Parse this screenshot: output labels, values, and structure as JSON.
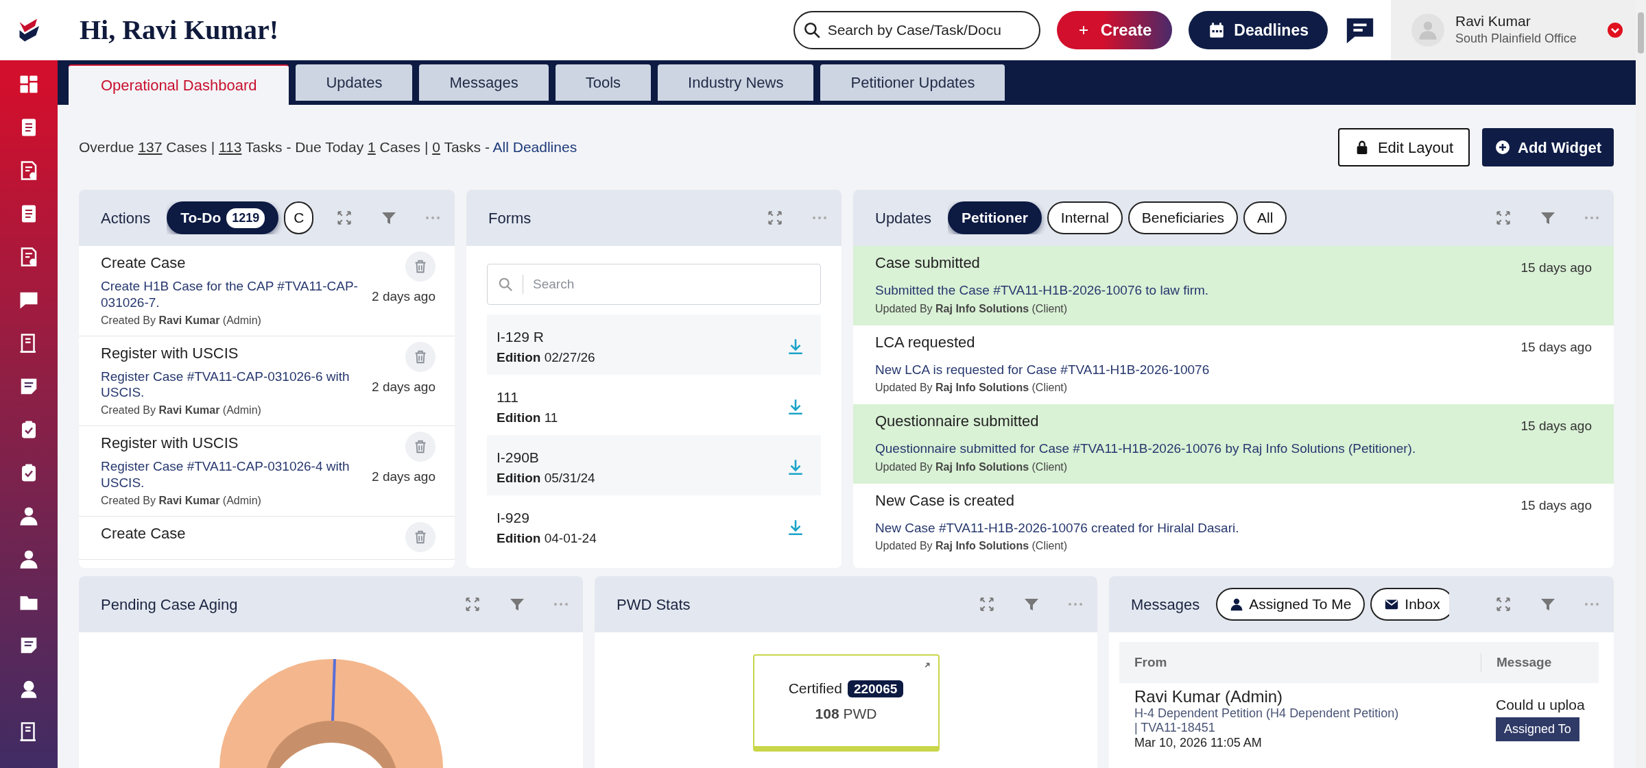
{
  "header": {
    "greeting": "Hi, Ravi Kumar!",
    "search": {
      "placeholder": "Search by Case/Task/Docu"
    },
    "create_button": "Create",
    "deadlines_button": "Deadlines",
    "user": {
      "name": "Ravi Kumar",
      "office": "South Plainfield Office"
    }
  },
  "tabs": [
    {
      "label": "Operational Dashboard",
      "selected": true
    },
    {
      "label": "Updates",
      "selected": false
    },
    {
      "label": "Messages",
      "selected": false
    },
    {
      "label": "Tools",
      "selected": false
    },
    {
      "label": "Industry News",
      "selected": false
    },
    {
      "label": "Petitioner Updates",
      "selected": false
    }
  ],
  "summary": [
    {
      "kind": "text",
      "text": "Overdue "
    },
    {
      "kind": "count",
      "text": "137"
    },
    {
      "kind": "text",
      "text": " Cases | "
    },
    {
      "kind": "count",
      "text": "113"
    },
    {
      "kind": "text",
      "text": " Tasks - Due Today "
    },
    {
      "kind": "count",
      "text": "1"
    },
    {
      "kind": "text",
      "text": " Cases | "
    },
    {
      "kind": "count",
      "text": "0"
    },
    {
      "kind": "text",
      "text": " Tasks - "
    },
    {
      "kind": "link",
      "text": "All Deadlines"
    }
  ],
  "toolbar": {
    "edit_layout": "Edit Layout",
    "add_widget": "Add Widget"
  },
  "actions": {
    "title": "Actions",
    "filters": [
      {
        "label": "To-Do",
        "count": "1219",
        "selected": true
      },
      {
        "label": "C",
        "selected": false
      }
    ],
    "items": [
      {
        "title": "Create Case",
        "description": "Create H1B Case for the CAP #TVA11-CAP-031026-7.",
        "created_by": "Created By **Ravi Kumar** (Admin)",
        "time": "2 days ago"
      },
      {
        "title": "Register with USCIS",
        "description": "Register Case #TVA11-CAP-031026-6 with USCIS.",
        "created_by": "Created By **Ravi Kumar** (Admin)",
        "time": "2 days ago"
      },
      {
        "title": "Register with USCIS",
        "description": "Register Case #TVA11-CAP-031026-4 with USCIS.",
        "created_by": "Created By **Ravi Kumar** (Admin)",
        "time": "2 days ago"
      },
      {
        "title": "Create Case"
      }
    ]
  },
  "forms": {
    "title": "Forms",
    "search": {
      "placeholder": "Search"
    },
    "items": [
      {
        "name": "I-129 R",
        "edition": "**Edition** 02/27/26"
      },
      {
        "name": "111",
        "edition": "**Edition** 11"
      },
      {
        "name": "I-290B",
        "edition": "**Edition** 05/31/24"
      },
      {
        "name": "I-929",
        "edition": "**Edition** 04-01-24"
      }
    ]
  },
  "updates": {
    "title": "Updates",
    "filters": [
      {
        "label": "Petitioner",
        "selected": true
      },
      {
        "label": "Internal",
        "selected": false
      },
      {
        "label": "Beneficiaries",
        "selected": false
      },
      {
        "label": "All",
        "selected": false
      }
    ],
    "items": [
      {
        "title": "Case submitted",
        "description": "Submitted the Case #TVA11-H1B-2026-10076 to law firm.",
        "updated_by": "Updated By **Raj Info Solutions** (Client)",
        "time": "15 days ago",
        "highlighted": true
      },
      {
        "title": "LCA requested",
        "description": "New LCA is requested for Case #TVA11-H1B-2026-10076",
        "updated_by": "Updated By **Raj Info Solutions** (Client)",
        "time": "15 days ago",
        "highlighted": false
      },
      {
        "title": "Questionnaire submitted",
        "description": "Questionnaire submitted for Case #TVA11-H1B-2026-10076 by Raj Info Solutions (Petitioner).",
        "updated_by": "Updated By **Raj Info Solutions** (Client)",
        "time": "15 days ago",
        "highlighted": true
      },
      {
        "title": "New Case is created",
        "description": "New Case #TVA11-H1B-2026-10076 created for Hiralal Dasari.",
        "updated_by": "Updated By **Raj Info Solutions** (Client)",
        "time": "15 days ago",
        "highlighted": false
      }
    ]
  },
  "pending_case_aging": {
    "title": "Pending Case Aging"
  },
  "pwd_stats": {
    "title": "PWD Stats",
    "card": {
      "label": "Certified",
      "count": "220065",
      "value": "**108** PWD"
    }
  },
  "messages": {
    "title": "Messages",
    "filters": [
      {
        "label": "Assigned To Me",
        "kind": "user",
        "selected": false
      },
      {
        "label": "Inbox",
        "kind": "mail",
        "selected": false
      }
    ],
    "columns": [
      "From",
      "Message"
    ],
    "rows": [
      {
        "from": "Ravi Kumar (Admin)",
        "subject": "H-4 Dependent Petition (H4 Dependent Petition)",
        "case": "| TVA11-18451",
        "date": "Mar 10, 2026 11:05 AM",
        "message": "Could u uploa",
        "badge": "Assigned To"
      }
    ]
  }
}
